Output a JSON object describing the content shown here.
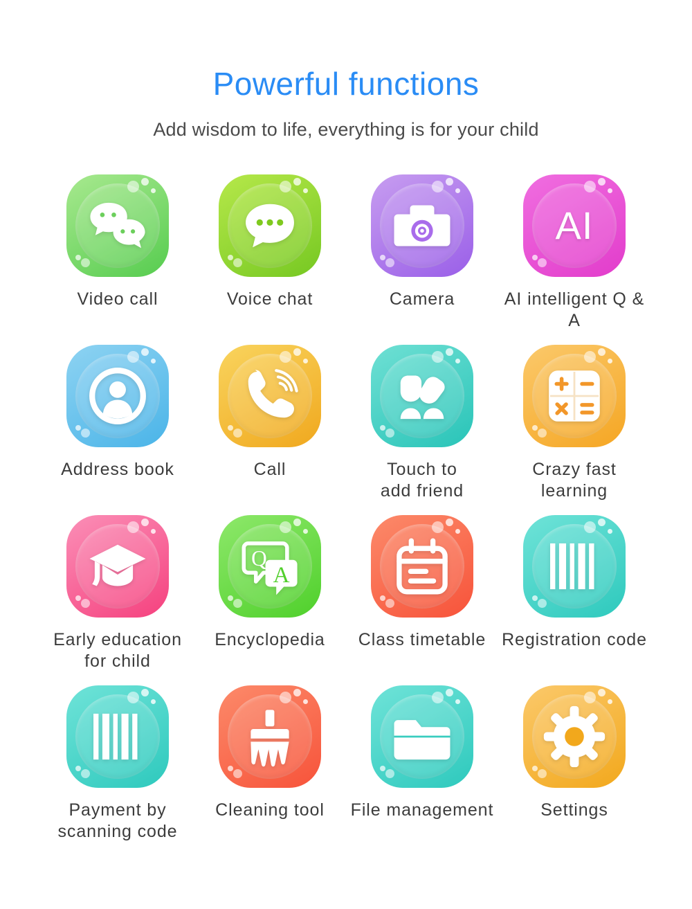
{
  "header": {
    "title": "Powerful functions",
    "subtitle": "Add wisdom to life, everything is for your child",
    "title_color": "#2a8cf5",
    "subtitle_color": "#4a4a4a"
  },
  "features": [
    {
      "label": "Video call",
      "icon": "chat-bubbles-icon",
      "color_from": "#a8e98f",
      "color_to": "#56cc4f",
      "glyph_color": "#ffffff"
    },
    {
      "label": "Voice chat",
      "icon": "speech-bubble-icon",
      "color_from": "#b6e84a",
      "color_to": "#76c822",
      "glyph_color": "#ffffff"
    },
    {
      "label": "Camera",
      "icon": "camera-icon",
      "color_from": "#c79df0",
      "color_to": "#9a5fe8",
      "glyph_color": "#ffffff"
    },
    {
      "label": "AI intelligent Q & A",
      "icon": "ai-badge-icon",
      "color_from": "#f06ee0",
      "color_to": "#e23ccb",
      "glyph_color": "#ffffff"
    },
    {
      "label": "Address book",
      "icon": "contact-person-icon",
      "color_from": "#8ed3f2",
      "color_to": "#4ab4e8",
      "glyph_color": "#ffffff"
    },
    {
      "label": "Call",
      "icon": "phone-handset-icon",
      "color_from": "#f9d45e",
      "color_to": "#f0a81e",
      "glyph_color": "#ffffff"
    },
    {
      "label": "Touch to\nadd friend",
      "icon": "two-people-icon",
      "color_from": "#6fe0d4",
      "color_to": "#29c4b8",
      "glyph_color": "#ffffff"
    },
    {
      "label": "Crazy fast\nlearning",
      "icon": "calculator-icon",
      "color_from": "#fbc96b",
      "color_to": "#f5a623",
      "glyph_color": "#f2972a"
    },
    {
      "label": "Early education\nfor child",
      "icon": "graduation-cap-icon",
      "color_from": "#fb8fb7",
      "color_to": "#f5417e",
      "glyph_color": "#ffffff"
    },
    {
      "label": "Encyclopedia",
      "icon": "qa-bubbles-icon",
      "color_from": "#8ee86b",
      "color_to": "#4fd02b",
      "glyph_color": "#ffffff"
    },
    {
      "label": "Class timetable",
      "icon": "calendar-icon",
      "color_from": "#fc8a6a",
      "color_to": "#f7533a",
      "glyph_color": "#ffffff"
    },
    {
      "label": "Registration code",
      "icon": "barcode-icon",
      "color_from": "#6fe3d8",
      "color_to": "#2ec9bd",
      "glyph_color": "#ffffff"
    },
    {
      "label": "Payment by\nscanning code",
      "icon": "barcode-icon",
      "color_from": "#6fe3d8",
      "color_to": "#2ec9bd",
      "glyph_color": "#ffffff"
    },
    {
      "label": "Cleaning tool",
      "icon": "broom-icon",
      "color_from": "#fc8a6a",
      "color_to": "#f7533a",
      "glyph_color": "#ffffff"
    },
    {
      "label": "File management",
      "icon": "folder-icon",
      "color_from": "#6fe3d8",
      "color_to": "#2ec9bd",
      "glyph_color": "#ffffff"
    },
    {
      "label": "Settings",
      "icon": "gear-icon",
      "color_from": "#fbc96b",
      "color_to": "#f2a81c",
      "glyph_color": "#ffffff"
    }
  ],
  "ai_badge_text": "AI",
  "calculator_symbols": [
    "+",
    "−",
    "×",
    "="
  ],
  "qa_letters": [
    "Q",
    "A"
  ]
}
